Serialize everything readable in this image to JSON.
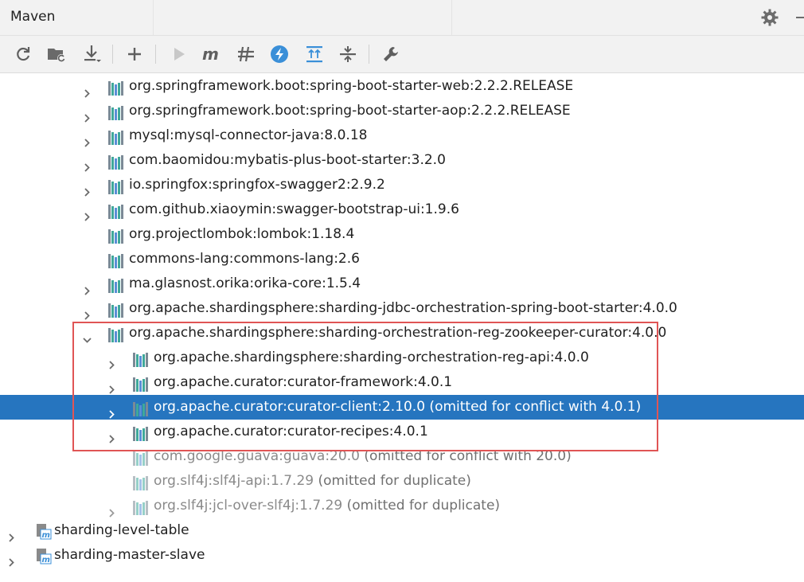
{
  "panel": {
    "title": "Maven"
  },
  "toolbar": {
    "buttons": [
      {
        "icon": "reload-icon"
      },
      {
        "icon": "folder-sync-icon"
      },
      {
        "icon": "download-icon"
      },
      {
        "icon": "plus-icon"
      },
      {
        "icon": "run-icon"
      },
      {
        "icon": "maven-m-icon"
      },
      {
        "icon": "skip-tests-icon"
      },
      {
        "icon": "lightning-icon"
      },
      {
        "icon": "expand-all-icon"
      },
      {
        "icon": "collapse-all-icon"
      },
      {
        "icon": "wrench-icon"
      }
    ]
  },
  "tree": {
    "rows": [
      {
        "text": "org.springframework.boot:spring-boot-starter-web:2.2.2.RELEASE",
        "omit": ""
      },
      {
        "text": "org.springframework.boot:spring-boot-starter-aop:2.2.2.RELEASE",
        "omit": ""
      },
      {
        "text": "mysql:mysql-connector-java:8.0.18",
        "omit": ""
      },
      {
        "text": "com.baomidou:mybatis-plus-boot-starter:3.2.0",
        "omit": ""
      },
      {
        "text": "io.springfox:springfox-swagger2:2.9.2",
        "omit": ""
      },
      {
        "text": "com.github.xiaoymin:swagger-bootstrap-ui:1.9.6",
        "omit": ""
      },
      {
        "text": "org.projectlombok:lombok:1.18.4",
        "omit": ""
      },
      {
        "text": "commons-lang:commons-lang:2.6",
        "omit": ""
      },
      {
        "text": "ma.glasnost.orika:orika-core:1.5.4",
        "omit": ""
      },
      {
        "text": "org.apache.shardingsphere:sharding-jdbc-orchestration-spring-boot-starter:4.0.0",
        "omit": ""
      },
      {
        "text": "org.apache.shardingsphere:sharding-orchestration-reg-zookeeper-curator:4.0.0",
        "omit": ""
      },
      {
        "text": "org.apache.shardingsphere:sharding-orchestration-reg-api:4.0.0",
        "omit": ""
      },
      {
        "text": "org.apache.curator:curator-framework:4.0.1",
        "omit": ""
      },
      {
        "text": "org.apache.curator:curator-client:2.10.0",
        "omit": " (omitted for conflict with 4.0.1)"
      },
      {
        "text": "org.apache.curator:curator-recipes:4.0.1",
        "omit": ""
      },
      {
        "text": "com.google.guava:guava:20.0",
        "omit": " (omitted for conflict with 20.0)"
      },
      {
        "text": "org.slf4j:slf4j-api:1.7.29",
        "omit": " (omitted for duplicate)"
      },
      {
        "text": "org.slf4j:jcl-over-slf4j:1.7.29",
        "omit": " (omitted for duplicate)"
      },
      {
        "text": "sharding-level-table",
        "omit": ""
      },
      {
        "text": "sharding-master-slave",
        "omit": ""
      }
    ]
  },
  "colors": {
    "selection": "#2675bf",
    "highlight_border": "#e05555",
    "lib_icon_teal": "#3fa89a",
    "lib_icon_blue": "#5b8ed6"
  }
}
